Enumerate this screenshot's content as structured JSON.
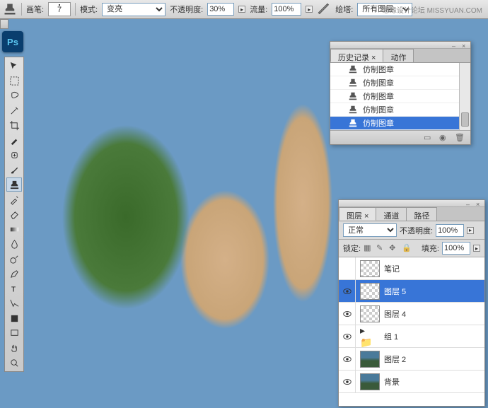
{
  "options_bar": {
    "brush_label": "画笔:",
    "brush_size": "7",
    "mode_label": "模式:",
    "mode_value": "变亮",
    "opacity_label": "不透明度:",
    "opacity_value": "30%",
    "flow_label": "流量:",
    "flow_value": "100%",
    "sample_label": "绘塔:",
    "sample_value": "所有图层"
  },
  "watermark": "思缘设计论坛 MISSYUAN.COM",
  "ps_logo": "Ps",
  "tools": [
    {
      "name": "move-tool"
    },
    {
      "name": "marquee-tool"
    },
    {
      "name": "lasso-tool"
    },
    {
      "name": "wand-tool"
    },
    {
      "name": "crop-tool"
    },
    {
      "name": "eyedropper-tool"
    },
    {
      "name": "healing-tool"
    },
    {
      "name": "brush-tool"
    },
    {
      "name": "stamp-tool",
      "active": true
    },
    {
      "name": "history-brush-tool"
    },
    {
      "name": "eraser-tool"
    },
    {
      "name": "gradient-tool"
    },
    {
      "name": "blur-tool"
    },
    {
      "name": "dodge-tool"
    },
    {
      "name": "pen-tool"
    },
    {
      "name": "type-tool"
    },
    {
      "name": "path-tool"
    },
    {
      "name": "shape-tool"
    },
    {
      "name": "notes-tool"
    },
    {
      "name": "hand-tool"
    },
    {
      "name": "zoom-tool"
    }
  ],
  "history_panel": {
    "tabs": [
      {
        "label": "历史记录",
        "active": true
      },
      {
        "label": "动作",
        "active": false
      }
    ],
    "items": [
      {
        "label": "仿制图章",
        "selected": false
      },
      {
        "label": "仿制图章",
        "selected": false
      },
      {
        "label": "仿制图章",
        "selected": false
      },
      {
        "label": "仿制图章",
        "selected": false
      },
      {
        "label": "仿制图章",
        "selected": true
      }
    ]
  },
  "layers_panel": {
    "tabs": [
      {
        "label": "图层",
        "active": true
      },
      {
        "label": "通道",
        "active": false
      },
      {
        "label": "路径",
        "active": false
      }
    ],
    "blend_mode": "正常",
    "opacity_label": "不透明度:",
    "opacity_value": "100%",
    "lock_label": "锁定:",
    "fill_label": "填充:",
    "fill_value": "100%",
    "layers": [
      {
        "name": "笔记",
        "visible": false,
        "thumb": "checker",
        "selected": false
      },
      {
        "name": "图层 5",
        "visible": true,
        "thumb": "checker",
        "selected": true
      },
      {
        "name": "图层 4",
        "visible": true,
        "thumb": "checker",
        "selected": false
      },
      {
        "name": "组 1",
        "visible": true,
        "thumb": "folder",
        "selected": false
      },
      {
        "name": "图层 2",
        "visible": true,
        "thumb": "img",
        "selected": false
      },
      {
        "name": "背景",
        "visible": true,
        "thumb": "img",
        "selected": false
      }
    ]
  }
}
